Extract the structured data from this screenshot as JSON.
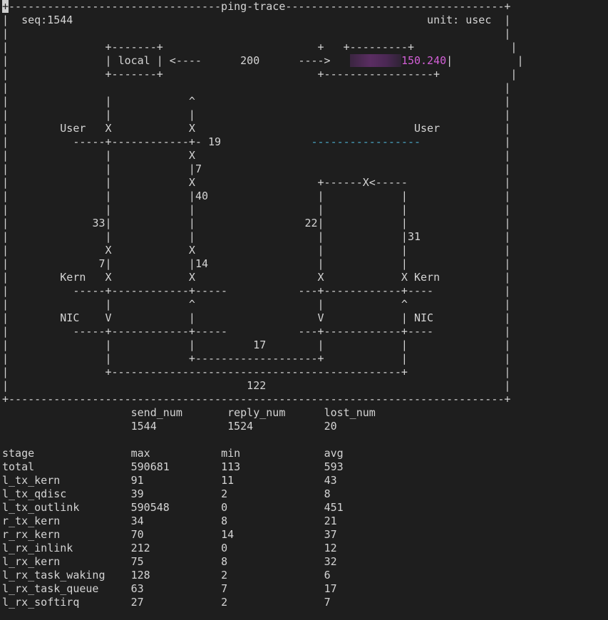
{
  "terminal": {
    "title": "ping-trace",
    "seq_label": "seq:1544",
    "unit_label": "unit: usec",
    "local_label": "local",
    "total_rtt": "200",
    "remote_host_redacted": "▇▇▇▇▇▇▇▇",
    "remote_ip_suffix": "150.240",
    "user_label": "User",
    "kern_label": "Kern",
    "nic_label": "NIC",
    "local_send_user_to_kern": "33",
    "local_send_kern_to_nic": "7",
    "local_recv_nic_to_kern": "14",
    "local_recv_kern_to_softirq": "40",
    "local_recv_softirq_to_user": "7",
    "local_user_gap": "19",
    "remote_recv": "22",
    "remote_send": "31",
    "wire_rtt": "17",
    "nic_rtt": "122",
    "colors": {
      "background": "#1e1e1e",
      "text": "#d4d4d4",
      "remote_user_line": "#4aa7c6",
      "remote_ip": "#d25fd6"
    },
    "cursor_icon": "block-cursor-icon"
  },
  "summary": {
    "headers": [
      "send_num",
      "reply_num",
      "lost_num"
    ],
    "values": [
      "1544",
      "1524",
      "20"
    ]
  },
  "stats": {
    "headers": [
      "stage",
      "max",
      "min",
      "avg"
    ],
    "rows": [
      {
        "stage": "total",
        "max": "590681",
        "min": "113",
        "avg": "593"
      },
      {
        "stage": "l_tx_kern",
        "max": "91",
        "min": "11",
        "avg": "43"
      },
      {
        "stage": "l_tx_qdisc",
        "max": "39",
        "min": "2",
        "avg": "8"
      },
      {
        "stage": "l_tx_outlink",
        "max": "590548",
        "min": "0",
        "avg": "451"
      },
      {
        "stage": "r_tx_kern",
        "max": "34",
        "min": "8",
        "avg": "21"
      },
      {
        "stage": "r_rx_kern",
        "max": "70",
        "min": "14",
        "avg": "37"
      },
      {
        "stage": "l_rx_inlink",
        "max": "212",
        "min": "0",
        "avg": "12"
      },
      {
        "stage": "l_rx_kern",
        "max": "75",
        "min": "8",
        "avg": "32"
      },
      {
        "stage": "l_rx_task_waking",
        "max": "128",
        "min": "2",
        "avg": "6"
      },
      {
        "stage": "l_rx_task_queue",
        "max": "63",
        "min": "7",
        "avg": "17"
      },
      {
        "stage": "l_rx_softirq",
        "max": "27",
        "min": "2",
        "avg": "7"
      }
    ]
  }
}
